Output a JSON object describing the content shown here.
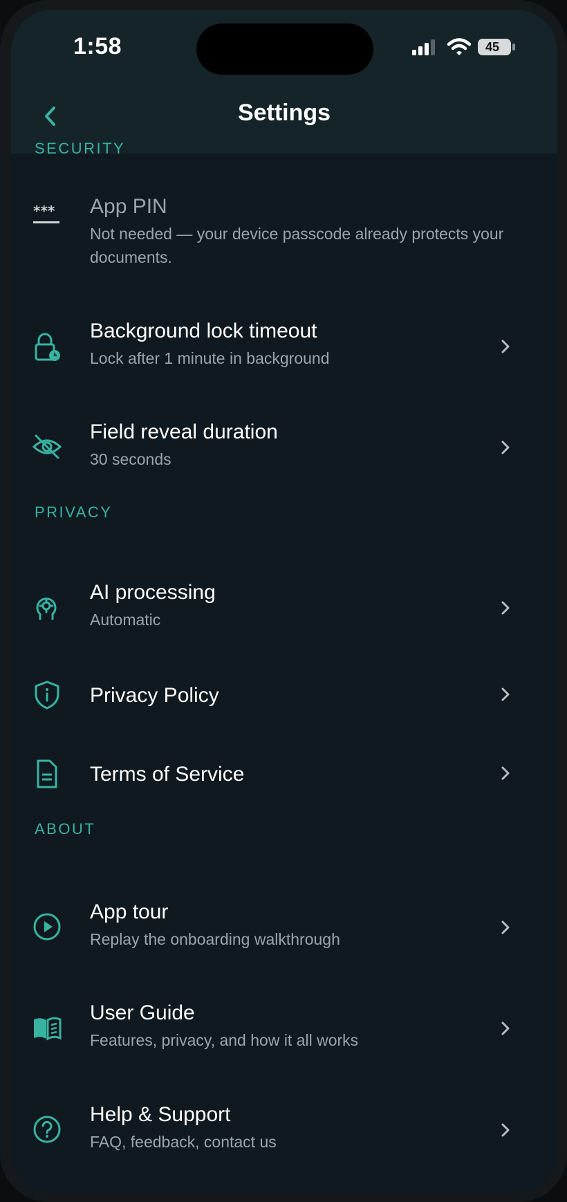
{
  "status_bar": {
    "time": "1:58",
    "battery": "45"
  },
  "nav": {
    "title": "Settings"
  },
  "sections": {
    "security": {
      "header": "SECURITY",
      "app_pin": {
        "title": "App PIN",
        "subtitle": "Not needed — your device passcode already protects your documents."
      },
      "background_lock": {
        "title": "Background lock timeout",
        "subtitle": "Lock after 1 minute in background"
      },
      "field_reveal": {
        "title": "Field reveal duration",
        "subtitle": "30 seconds"
      }
    },
    "privacy": {
      "header": "PRIVACY",
      "ai_processing": {
        "title": "AI processing",
        "subtitle": "Automatic"
      },
      "privacy_policy": {
        "title": "Privacy Policy"
      },
      "terms": {
        "title": "Terms of Service"
      }
    },
    "about": {
      "header": "ABOUT",
      "app_tour": {
        "title": "App tour",
        "subtitle": "Replay the onboarding walkthrough"
      },
      "user_guide": {
        "title": "User Guide",
        "subtitle": "Features, privacy, and how it all works"
      },
      "help": {
        "title": "Help & Support",
        "subtitle": "FAQ, feedback, contact us"
      }
    }
  },
  "colors": {
    "accent": "#38b3a2",
    "background": "#101920",
    "header": "#152429"
  },
  "icons": {
    "back": "chevron-left-icon",
    "pin": "password-icon",
    "lock": "lock-clock-icon",
    "eye": "eye-off-icon",
    "ai": "brain-head-icon",
    "shield": "shield-info-icon",
    "doc": "document-icon",
    "play": "play-circle-icon",
    "book": "book-icon",
    "help": "question-circle-icon",
    "chevron": "chevron-right-icon"
  }
}
